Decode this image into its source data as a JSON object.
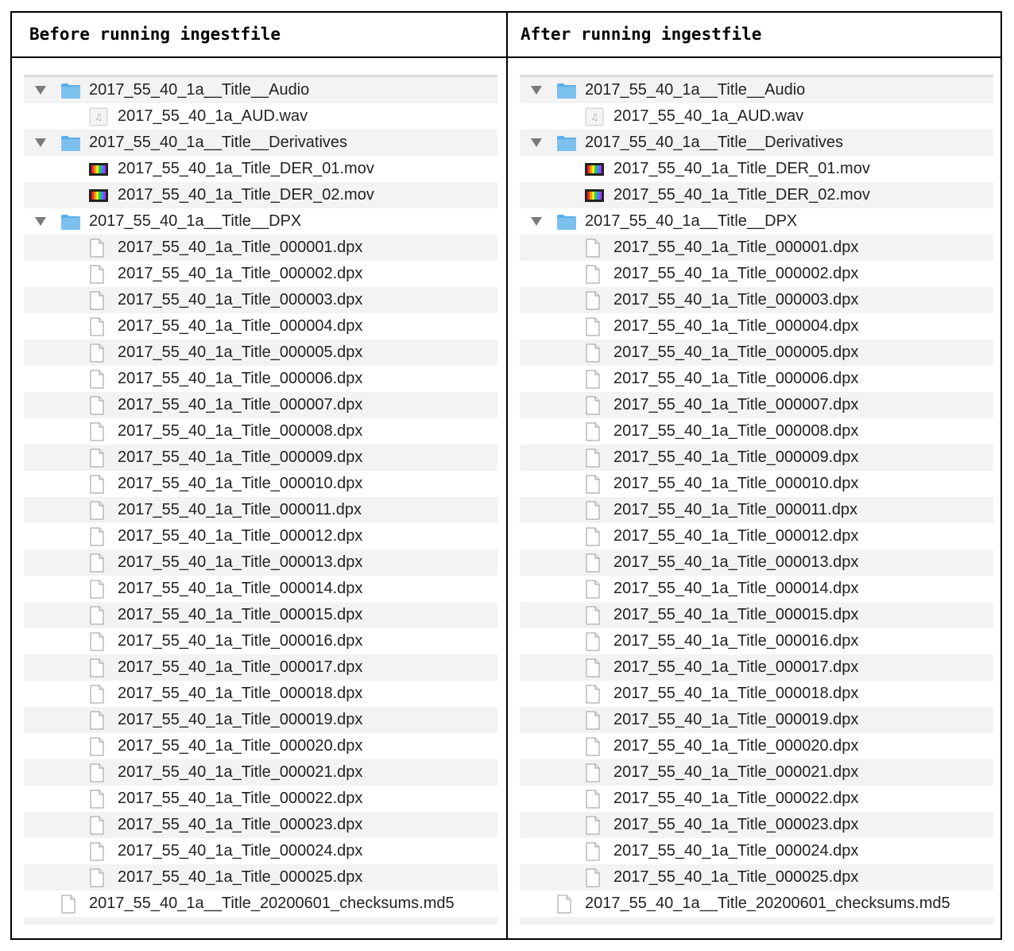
{
  "panels": [
    {
      "header": "Before running ingestfile",
      "rows": [
        {
          "level": 0,
          "type": "folder",
          "label": "2017_55_40_1a__Title__Audio"
        },
        {
          "level": 1,
          "type": "audio",
          "label": "2017_55_40_1a_AUD.wav"
        },
        {
          "level": 0,
          "type": "folder",
          "label": "2017_55_40_1a__Title__Derivatives"
        },
        {
          "level": 1,
          "type": "movie",
          "label": "2017_55_40_1a_Title_DER_01.mov"
        },
        {
          "level": 1,
          "type": "movie",
          "label": "2017_55_40_1a_Title_DER_02.mov"
        },
        {
          "level": 0,
          "type": "folder",
          "label": "2017_55_40_1a__Title__DPX"
        },
        {
          "level": 1,
          "type": "file",
          "label": "2017_55_40_1a_Title_000001.dpx"
        },
        {
          "level": 1,
          "type": "file",
          "label": "2017_55_40_1a_Title_000002.dpx"
        },
        {
          "level": 1,
          "type": "file",
          "label": "2017_55_40_1a_Title_000003.dpx"
        },
        {
          "level": 1,
          "type": "file",
          "label": "2017_55_40_1a_Title_000004.dpx"
        },
        {
          "level": 1,
          "type": "file",
          "label": "2017_55_40_1a_Title_000005.dpx"
        },
        {
          "level": 1,
          "type": "file",
          "label": "2017_55_40_1a_Title_000006.dpx"
        },
        {
          "level": 1,
          "type": "file",
          "label": "2017_55_40_1a_Title_000007.dpx"
        },
        {
          "level": 1,
          "type": "file",
          "label": "2017_55_40_1a_Title_000008.dpx"
        },
        {
          "level": 1,
          "type": "file",
          "label": "2017_55_40_1a_Title_000009.dpx"
        },
        {
          "level": 1,
          "type": "file",
          "label": "2017_55_40_1a_Title_000010.dpx"
        },
        {
          "level": 1,
          "type": "file",
          "label": "2017_55_40_1a_Title_000011.dpx"
        },
        {
          "level": 1,
          "type": "file",
          "label": "2017_55_40_1a_Title_000012.dpx"
        },
        {
          "level": 1,
          "type": "file",
          "label": "2017_55_40_1a_Title_000013.dpx"
        },
        {
          "level": 1,
          "type": "file",
          "label": "2017_55_40_1a_Title_000014.dpx"
        },
        {
          "level": 1,
          "type": "file",
          "label": "2017_55_40_1a_Title_000015.dpx"
        },
        {
          "level": 1,
          "type": "file",
          "label": "2017_55_40_1a_Title_000016.dpx"
        },
        {
          "level": 1,
          "type": "file",
          "label": "2017_55_40_1a_Title_000017.dpx"
        },
        {
          "level": 1,
          "type": "file",
          "label": "2017_55_40_1a_Title_000018.dpx"
        },
        {
          "level": 1,
          "type": "file",
          "label": "2017_55_40_1a_Title_000019.dpx"
        },
        {
          "level": 1,
          "type": "file",
          "label": "2017_55_40_1a_Title_000020.dpx"
        },
        {
          "level": 1,
          "type": "file",
          "label": "2017_55_40_1a_Title_000021.dpx"
        },
        {
          "level": 1,
          "type": "file",
          "label": "2017_55_40_1a_Title_000022.dpx"
        },
        {
          "level": 1,
          "type": "file",
          "label": "2017_55_40_1a_Title_000023.dpx"
        },
        {
          "level": 1,
          "type": "file",
          "label": "2017_55_40_1a_Title_000024.dpx"
        },
        {
          "level": 1,
          "type": "file",
          "label": "2017_55_40_1a_Title_000025.dpx"
        },
        {
          "level": 0,
          "type": "file",
          "label": "2017_55_40_1a__Title_20200601_checksums.md5"
        }
      ]
    },
    {
      "header": "After running ingestfile",
      "rows": [
        {
          "level": 0,
          "type": "folder",
          "label": "2017_55_40_1a__Title__Audio"
        },
        {
          "level": 1,
          "type": "audio",
          "label": "2017_55_40_1a_AUD.wav"
        },
        {
          "level": 0,
          "type": "folder",
          "label": "2017_55_40_1a__Title__Derivatives"
        },
        {
          "level": 1,
          "type": "movie",
          "label": "2017_55_40_1a_Title_DER_01.mov"
        },
        {
          "level": 1,
          "type": "movie",
          "label": "2017_55_40_1a_Title_DER_02.mov"
        },
        {
          "level": 0,
          "type": "folder",
          "label": "2017_55_40_1a__Title__DPX"
        },
        {
          "level": 1,
          "type": "file",
          "label": "2017_55_40_1a_Title_000001.dpx"
        },
        {
          "level": 1,
          "type": "file",
          "label": "2017_55_40_1a_Title_000002.dpx"
        },
        {
          "level": 1,
          "type": "file",
          "label": "2017_55_40_1a_Title_000003.dpx"
        },
        {
          "level": 1,
          "type": "file",
          "label": "2017_55_40_1a_Title_000004.dpx"
        },
        {
          "level": 1,
          "type": "file",
          "label": "2017_55_40_1a_Title_000005.dpx"
        },
        {
          "level": 1,
          "type": "file",
          "label": "2017_55_40_1a_Title_000006.dpx"
        },
        {
          "level": 1,
          "type": "file",
          "label": "2017_55_40_1a_Title_000007.dpx"
        },
        {
          "level": 1,
          "type": "file",
          "label": "2017_55_40_1a_Title_000008.dpx"
        },
        {
          "level": 1,
          "type": "file",
          "label": "2017_55_40_1a_Title_000009.dpx"
        },
        {
          "level": 1,
          "type": "file",
          "label": "2017_55_40_1a_Title_000010.dpx"
        },
        {
          "level": 1,
          "type": "file",
          "label": "2017_55_40_1a_Title_000011.dpx"
        },
        {
          "level": 1,
          "type": "file",
          "label": "2017_55_40_1a_Title_000012.dpx"
        },
        {
          "level": 1,
          "type": "file",
          "label": "2017_55_40_1a_Title_000013.dpx"
        },
        {
          "level": 1,
          "type": "file",
          "label": "2017_55_40_1a_Title_000014.dpx"
        },
        {
          "level": 1,
          "type": "file",
          "label": "2017_55_40_1a_Title_000015.dpx"
        },
        {
          "level": 1,
          "type": "file",
          "label": "2017_55_40_1a_Title_000016.dpx"
        },
        {
          "level": 1,
          "type": "file",
          "label": "2017_55_40_1a_Title_000017.dpx"
        },
        {
          "level": 1,
          "type": "file",
          "label": "2017_55_40_1a_Title_000018.dpx"
        },
        {
          "level": 1,
          "type": "file",
          "label": "2017_55_40_1a_Title_000019.dpx"
        },
        {
          "level": 1,
          "type": "file",
          "label": "2017_55_40_1a_Title_000020.dpx"
        },
        {
          "level": 1,
          "type": "file",
          "label": "2017_55_40_1a_Title_000021.dpx"
        },
        {
          "level": 1,
          "type": "file",
          "label": "2017_55_40_1a_Title_000022.dpx"
        },
        {
          "level": 1,
          "type": "file",
          "label": "2017_55_40_1a_Title_000023.dpx"
        },
        {
          "level": 1,
          "type": "file",
          "label": "2017_55_40_1a_Title_000024.dpx"
        },
        {
          "level": 1,
          "type": "file",
          "label": "2017_55_40_1a_Title_000025.dpx"
        },
        {
          "level": 0,
          "type": "file",
          "label": "2017_55_40_1a__Title_20200601_checksums.md5"
        }
      ]
    }
  ],
  "colors": {
    "folder": "#5aaeea",
    "stripe": "#f3f3f3",
    "text": "#222222"
  }
}
